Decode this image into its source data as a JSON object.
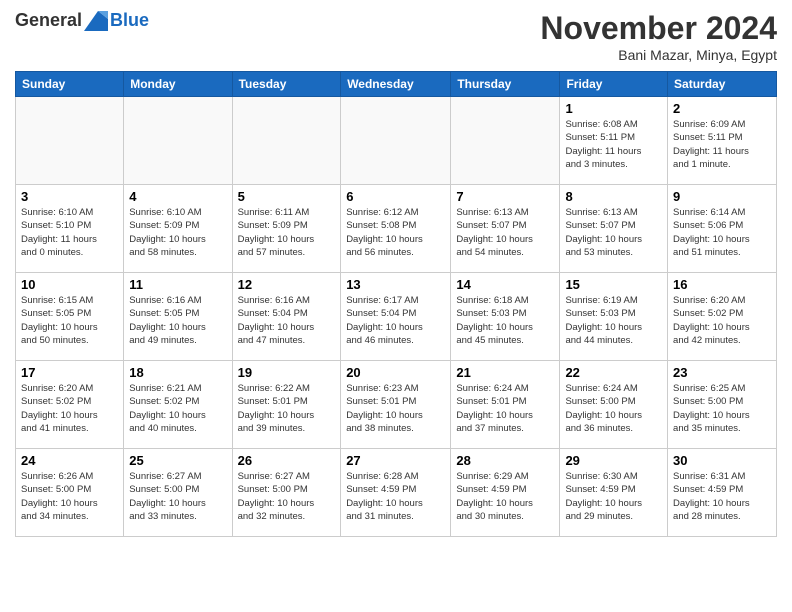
{
  "header": {
    "logo_general": "General",
    "logo_blue": "Blue",
    "month": "November 2024",
    "location": "Bani Mazar, Minya, Egypt"
  },
  "weekdays": [
    "Sunday",
    "Monday",
    "Tuesday",
    "Wednesday",
    "Thursday",
    "Friday",
    "Saturday"
  ],
  "weeks": [
    [
      {
        "day": "",
        "info": ""
      },
      {
        "day": "",
        "info": ""
      },
      {
        "day": "",
        "info": ""
      },
      {
        "day": "",
        "info": ""
      },
      {
        "day": "",
        "info": ""
      },
      {
        "day": "1",
        "info": "Sunrise: 6:08 AM\nSunset: 5:11 PM\nDaylight: 11 hours\nand 3 minutes."
      },
      {
        "day": "2",
        "info": "Sunrise: 6:09 AM\nSunset: 5:11 PM\nDaylight: 11 hours\nand 1 minute."
      }
    ],
    [
      {
        "day": "3",
        "info": "Sunrise: 6:10 AM\nSunset: 5:10 PM\nDaylight: 11 hours\nand 0 minutes."
      },
      {
        "day": "4",
        "info": "Sunrise: 6:10 AM\nSunset: 5:09 PM\nDaylight: 10 hours\nand 58 minutes."
      },
      {
        "day": "5",
        "info": "Sunrise: 6:11 AM\nSunset: 5:09 PM\nDaylight: 10 hours\nand 57 minutes."
      },
      {
        "day": "6",
        "info": "Sunrise: 6:12 AM\nSunset: 5:08 PM\nDaylight: 10 hours\nand 56 minutes."
      },
      {
        "day": "7",
        "info": "Sunrise: 6:13 AM\nSunset: 5:07 PM\nDaylight: 10 hours\nand 54 minutes."
      },
      {
        "day": "8",
        "info": "Sunrise: 6:13 AM\nSunset: 5:07 PM\nDaylight: 10 hours\nand 53 minutes."
      },
      {
        "day": "9",
        "info": "Sunrise: 6:14 AM\nSunset: 5:06 PM\nDaylight: 10 hours\nand 51 minutes."
      }
    ],
    [
      {
        "day": "10",
        "info": "Sunrise: 6:15 AM\nSunset: 5:05 PM\nDaylight: 10 hours\nand 50 minutes."
      },
      {
        "day": "11",
        "info": "Sunrise: 6:16 AM\nSunset: 5:05 PM\nDaylight: 10 hours\nand 49 minutes."
      },
      {
        "day": "12",
        "info": "Sunrise: 6:16 AM\nSunset: 5:04 PM\nDaylight: 10 hours\nand 47 minutes."
      },
      {
        "day": "13",
        "info": "Sunrise: 6:17 AM\nSunset: 5:04 PM\nDaylight: 10 hours\nand 46 minutes."
      },
      {
        "day": "14",
        "info": "Sunrise: 6:18 AM\nSunset: 5:03 PM\nDaylight: 10 hours\nand 45 minutes."
      },
      {
        "day": "15",
        "info": "Sunrise: 6:19 AM\nSunset: 5:03 PM\nDaylight: 10 hours\nand 44 minutes."
      },
      {
        "day": "16",
        "info": "Sunrise: 6:20 AM\nSunset: 5:02 PM\nDaylight: 10 hours\nand 42 minutes."
      }
    ],
    [
      {
        "day": "17",
        "info": "Sunrise: 6:20 AM\nSunset: 5:02 PM\nDaylight: 10 hours\nand 41 minutes."
      },
      {
        "day": "18",
        "info": "Sunrise: 6:21 AM\nSunset: 5:02 PM\nDaylight: 10 hours\nand 40 minutes."
      },
      {
        "day": "19",
        "info": "Sunrise: 6:22 AM\nSunset: 5:01 PM\nDaylight: 10 hours\nand 39 minutes."
      },
      {
        "day": "20",
        "info": "Sunrise: 6:23 AM\nSunset: 5:01 PM\nDaylight: 10 hours\nand 38 minutes."
      },
      {
        "day": "21",
        "info": "Sunrise: 6:24 AM\nSunset: 5:01 PM\nDaylight: 10 hours\nand 37 minutes."
      },
      {
        "day": "22",
        "info": "Sunrise: 6:24 AM\nSunset: 5:00 PM\nDaylight: 10 hours\nand 36 minutes."
      },
      {
        "day": "23",
        "info": "Sunrise: 6:25 AM\nSunset: 5:00 PM\nDaylight: 10 hours\nand 35 minutes."
      }
    ],
    [
      {
        "day": "24",
        "info": "Sunrise: 6:26 AM\nSunset: 5:00 PM\nDaylight: 10 hours\nand 34 minutes."
      },
      {
        "day": "25",
        "info": "Sunrise: 6:27 AM\nSunset: 5:00 PM\nDaylight: 10 hours\nand 33 minutes."
      },
      {
        "day": "26",
        "info": "Sunrise: 6:27 AM\nSunset: 5:00 PM\nDaylight: 10 hours\nand 32 minutes."
      },
      {
        "day": "27",
        "info": "Sunrise: 6:28 AM\nSunset: 4:59 PM\nDaylight: 10 hours\nand 31 minutes."
      },
      {
        "day": "28",
        "info": "Sunrise: 6:29 AM\nSunset: 4:59 PM\nDaylight: 10 hours\nand 30 minutes."
      },
      {
        "day": "29",
        "info": "Sunrise: 6:30 AM\nSunset: 4:59 PM\nDaylight: 10 hours\nand 29 minutes."
      },
      {
        "day": "30",
        "info": "Sunrise: 6:31 AM\nSunset: 4:59 PM\nDaylight: 10 hours\nand 28 minutes."
      }
    ]
  ]
}
